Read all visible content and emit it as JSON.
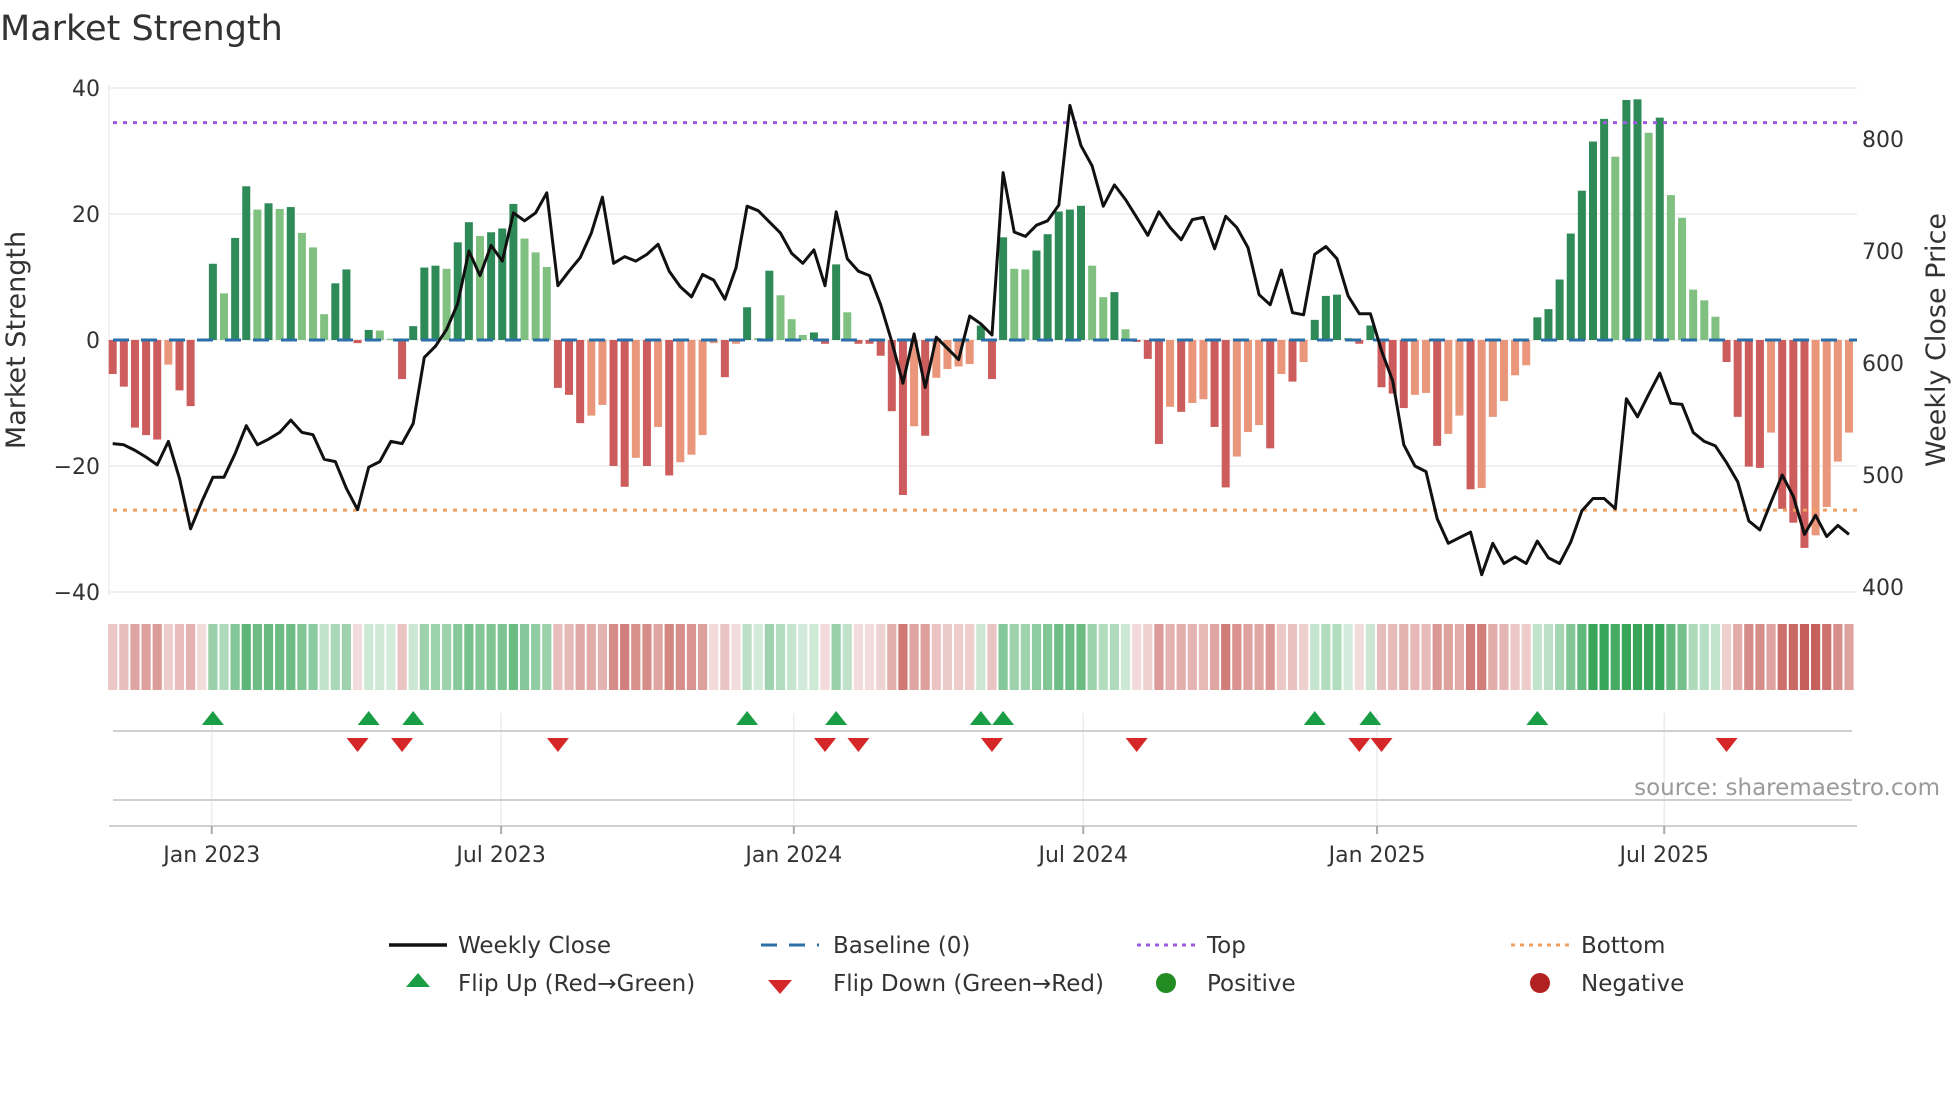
{
  "chart_data": {
    "type": "bar",
    "title": "Market Strength",
    "ylabel": "Market Strength",
    "y2label": "Weekly Close Price",
    "ylim": [
      -40,
      40
    ],
    "y2lim": [
      400,
      850
    ],
    "yticks": [
      "40",
      "20",
      "0",
      "−20",
      "−40"
    ],
    "ytick_values": [
      40,
      20,
      0,
      -20,
      -40
    ],
    "y2ticks": [
      "800",
      "700",
      "600",
      "500",
      "400"
    ],
    "y2tick_values": [
      800,
      700,
      600,
      500,
      400
    ],
    "xticks": [
      {
        "label": "Jan 2023",
        "week": 9.9
      },
      {
        "label": "Jul 2023",
        "week": 35.9
      },
      {
        "label": "Jan 2024",
        "week": 62.2
      },
      {
        "label": "Jul 2024",
        "week": 88.2
      },
      {
        "label": "Jan 2025",
        "week": 114.6
      },
      {
        "label": "Jul 2025",
        "week": 140.4
      }
    ],
    "top_level": 34.5,
    "bottom_level": -27,
    "baseline": 0,
    "strength": [
      -5.4,
      -7.4,
      -13.9,
      -15.1,
      -15.8,
      -3.9,
      -8.0,
      -10.5,
      -0.1,
      12.1,
      7.4,
      16.2,
      24.4,
      20.7,
      21.7,
      20.8,
      21.1,
      17.0,
      14.7,
      4.1,
      9.0,
      11.2,
      -0.5,
      1.6,
      1.5,
      0.2,
      -6.2,
      2.2,
      11.5,
      11.8,
      11.3,
      15.5,
      18.7,
      16.5,
      17.1,
      17.7,
      21.6,
      16.1,
      13.9,
      11.6,
      -7.6,
      -8.7,
      -13.2,
      -12.0,
      -10.3,
      -20.0,
      -23.3,
      -18.7,
      -20.0,
      -13.8,
      -21.5,
      -19.4,
      -18.2,
      -15.1,
      -0.5,
      -5.9,
      -0.6,
      5.2,
      0.3,
      11.0,
      7.1,
      3.3,
      0.8,
      1.2,
      -0.6,
      12.0,
      4.4,
      -0.6,
      -0.6,
      -2.5,
      -11.3,
      -24.6,
      -13.7,
      -15.2,
      -6.0,
      -4.6,
      -4.2,
      -3.8,
      2.3,
      -6.2,
      16.3,
      11.3,
      11.2,
      14.2,
      16.8,
      20.4,
      20.7,
      21.3,
      11.8,
      6.8,
      7.6,
      1.7,
      -0.3,
      -3.0,
      -16.5,
      -10.6,
      -11.4,
      -10.0,
      -9.4,
      -13.8,
      -23.4,
      -18.5,
      -14.6,
      -13.5,
      -17.2,
      -5.4,
      -6.6,
      -3.5,
      3.2,
      7.0,
      7.2,
      0.3,
      -0.6,
      2.3,
      -7.5,
      -8.5,
      -10.8,
      -8.7,
      -8.4,
      -16.8,
      -14.9,
      -12.0,
      -23.7,
      -23.5,
      -12.2,
      -9.7,
      -5.6,
      -4.0,
      3.6,
      4.9,
      9.6,
      16.9,
      23.7,
      31.5,
      35.1,
      29.1,
      38.1,
      38.2,
      32.9,
      35.3,
      23.0,
      19.4,
      8.0,
      6.3,
      3.7,
      -3.5,
      -12.2,
      -20.1,
      -20.3,
      -14.7,
      -26.8,
      -29.0,
      -33.0,
      -31.0,
      -26.5,
      -19.3,
      -14.7
    ],
    "weekly_close": [
      528,
      527,
      522,
      516,
      509,
      530,
      497,
      452,
      476,
      498,
      498,
      519,
      544,
      527,
      532,
      538,
      549,
      538,
      536,
      514,
      512,
      488,
      469,
      507,
      512,
      530,
      528,
      546,
      605,
      615,
      630,
      653,
      700,
      678,
      705,
      691,
      734,
      727,
      734,
      752,
      669,
      682,
      694,
      716,
      748,
      689,
      695,
      691,
      697,
      706,
      682,
      668,
      659,
      679,
      674,
      657,
      685,
      740,
      736,
      726,
      716,
      698,
      689,
      701,
      669,
      735,
      693,
      682,
      678,
      652,
      619,
      582,
      626,
      578,
      623,
      613,
      603,
      642,
      635,
      625,
      770,
      717,
      713,
      723,
      727,
      741,
      830,
      794,
      776,
      740,
      759,
      746,
      730,
      714,
      735,
      721,
      710,
      728,
      730,
      702,
      731,
      721,
      703,
      661,
      652,
      683,
      645,
      643,
      697,
      704,
      693,
      660,
      644,
      644,
      611,
      584,
      527,
      508,
      503,
      461,
      439,
      444,
      449,
      411,
      439,
      421,
      427,
      421,
      441,
      426,
      421,
      440,
      468,
      479,
      479,
      470,
      568,
      552,
      572,
      591,
      564,
      563,
      538,
      530,
      526,
      511,
      494,
      459,
      451,
      476,
      500,
      481,
      447,
      464,
      445,
      455,
      447
    ],
    "flip_up_weeks": [
      10,
      24,
      28,
      58,
      66,
      79,
      81,
      109,
      114,
      129
    ],
    "flip_down_weeks": [
      23,
      27,
      41,
      65,
      68,
      80,
      93,
      113,
      115,
      146
    ],
    "legend": {
      "placement": "bottom",
      "weekly_close": "Weekly Close",
      "baseline": "Baseline (0)",
      "top": "Top",
      "bottom": "Bottom",
      "flip_up": "Flip Up (Red→Green)",
      "flip_down": "Flip Down (Green→Red)",
      "positive": "Positive",
      "negative": "Negative"
    },
    "source": "source: sharemaestro.com",
    "colors": {
      "pos_rising": "#2e8b57",
      "pos_falling": "#80c080",
      "neg_falling": "#cd5c5c",
      "neg_rising": "#e9967a",
      "baseline": "#2b6fa8",
      "top": "#9d5ce0",
      "bottom": "#f0a060",
      "flip_up": "#1a9e45",
      "flip_down": "#d62728",
      "positive": "#228b22",
      "negative": "#b22222",
      "close": "#111111"
    }
  }
}
